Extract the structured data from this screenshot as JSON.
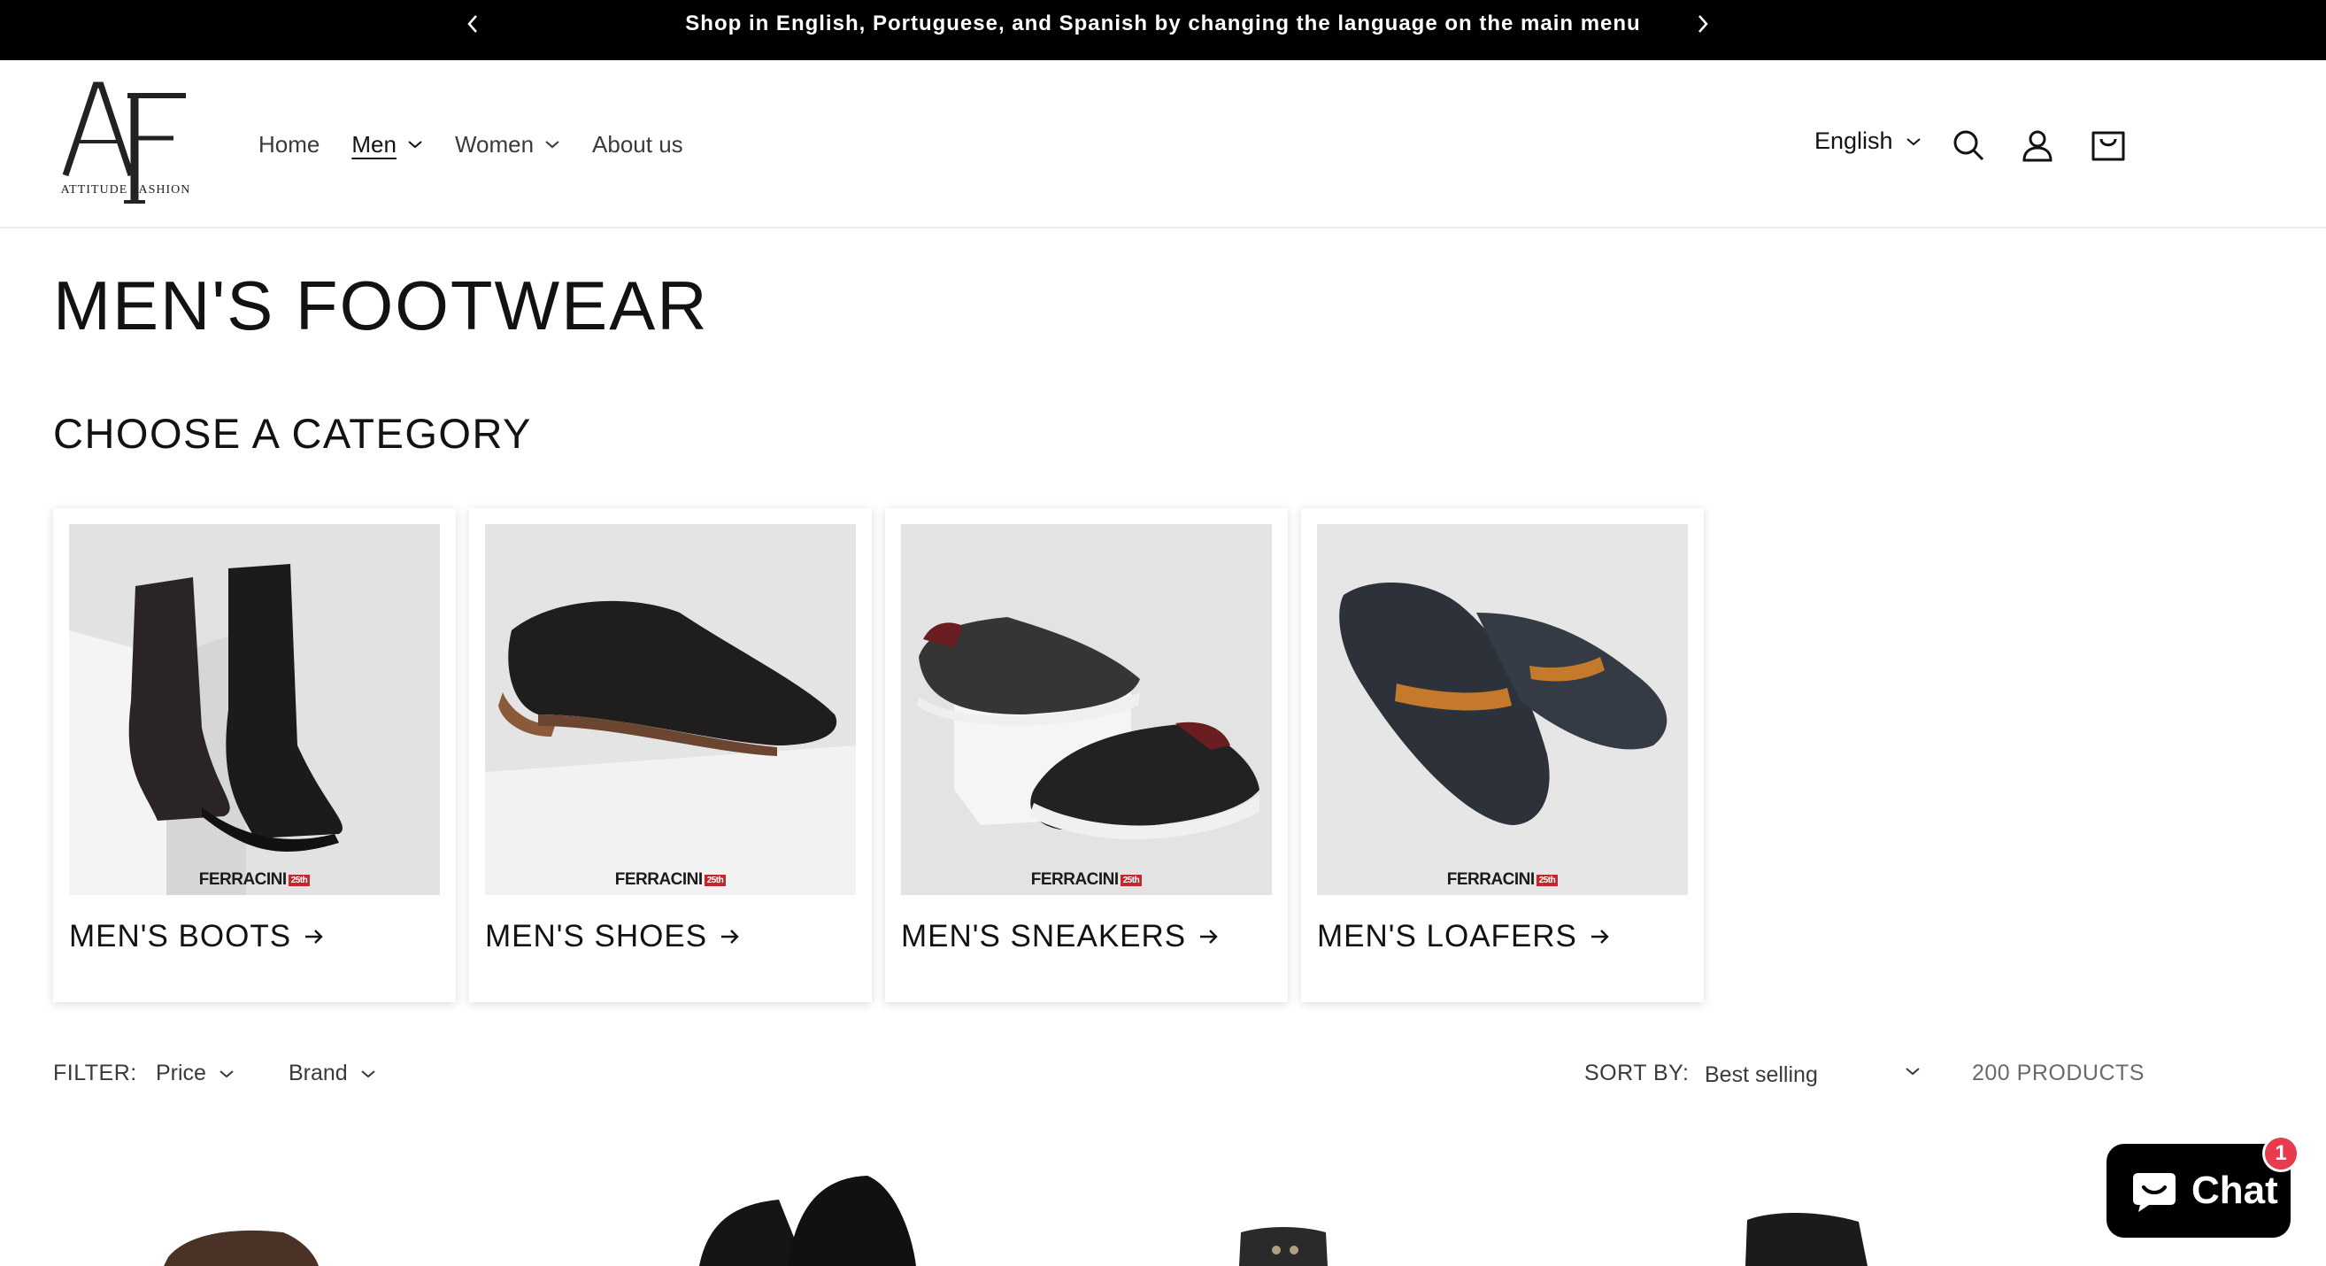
{
  "announcement": {
    "text": "Shop in English, Portuguese, and Spanish by changing the language on the main menu",
    "prev_icon": "chevron-left-icon",
    "next_icon": "chevron-right-icon"
  },
  "header": {
    "logo": {
      "monogram": "AF",
      "name": "ATTITUDE FASHION"
    },
    "nav": [
      {
        "label": "Home",
        "has_dropdown": false,
        "active": false
      },
      {
        "label": "Men",
        "has_dropdown": true,
        "active": true
      },
      {
        "label": "Women",
        "has_dropdown": true,
        "active": false
      },
      {
        "label": "About us",
        "has_dropdown": false,
        "active": false
      }
    ],
    "language": "English",
    "icons": [
      "search-icon",
      "account-icon",
      "cart-icon"
    ]
  },
  "page": {
    "title": "MEN'S FOOTWEAR",
    "section_title": "CHOOSE A CATEGORY"
  },
  "categories": [
    {
      "label": "MEN'S BOOTS",
      "brand": "FERRACINI",
      "brand_tag": "25th"
    },
    {
      "label": "MEN'S SHOES",
      "brand": "FERRACINI",
      "brand_tag": "25th"
    },
    {
      "label": "MEN'S SNEAKERS",
      "brand": "FERRACINI",
      "brand_tag": "25th"
    },
    {
      "label": "MEN'S LOAFERS",
      "brand": "FERRACINI",
      "brand_tag": "25th"
    }
  ],
  "filters": {
    "label": "FILTER:",
    "options": [
      "Price",
      "Brand"
    ],
    "sort_label": "SORT BY:",
    "sort_value": "Best selling",
    "product_count": "200 PRODUCTS"
  },
  "chat": {
    "label": "Chat",
    "badge": "1"
  },
  "colors": {
    "announcement_bg": "#000000",
    "text": "#121212",
    "chat_badge": "#e63c4d",
    "brand_tag": "#c0282d"
  }
}
